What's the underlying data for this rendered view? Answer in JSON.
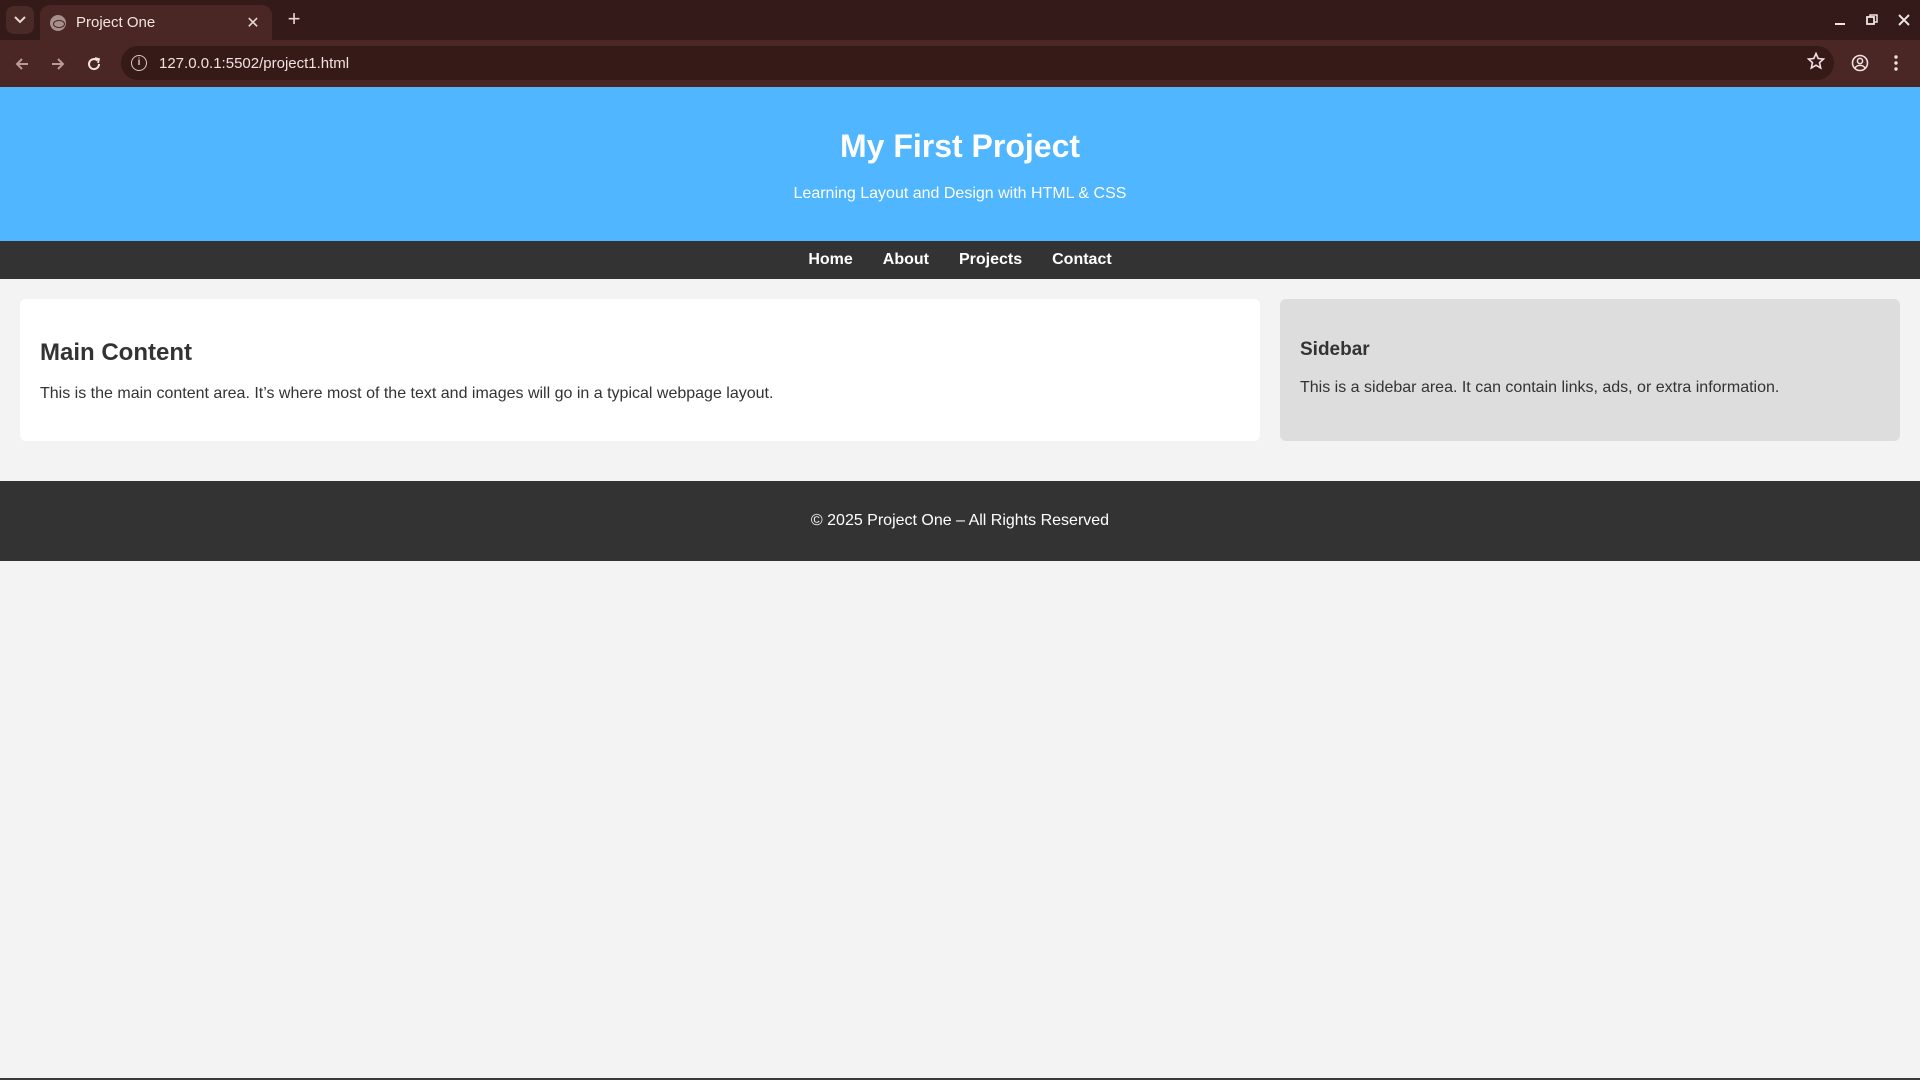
{
  "browser": {
    "tab_title": "Project One",
    "tab_close": "✕",
    "new_tab": "+",
    "url": "127.0.0.1:5502/project1.html"
  },
  "site": {
    "title": "My First Project",
    "subtitle": "Learning Layout and Design with HTML & CSS",
    "nav": [
      "Home",
      "About",
      "Projects",
      "Contact"
    ],
    "main": {
      "heading": "Main Content",
      "text": "This is the main content area. It’s where most of the text and images will go in a typical webpage layout."
    },
    "sidebar": {
      "heading": "Sidebar",
      "text": "This is a sidebar area. It can contain links, ads, or extra information."
    },
    "footer": "© 2025 Project One – All Rights Reserved"
  },
  "colors": {
    "header_bg": "#4fb6ff",
    "nav_bg": "#333333",
    "sidebar_bg": "#dddddd",
    "browser_frame": "#341a18"
  },
  "icons": [
    "tab-list-icon",
    "globe-icon",
    "close-icon",
    "plus-icon",
    "minimize-icon",
    "restore-icon",
    "window-close-icon",
    "back-arrow-icon",
    "forward-arrow-icon",
    "reload-icon",
    "info-icon",
    "star-icon",
    "profile-icon",
    "menu-dots-icon"
  ]
}
